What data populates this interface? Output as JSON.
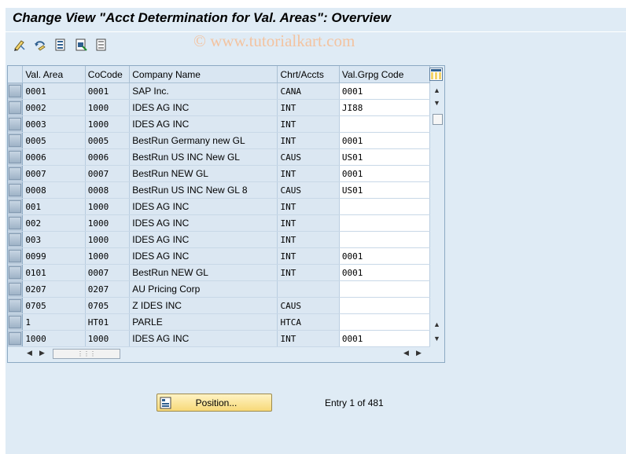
{
  "title": "Change View \"Acct Determination for Val. Areas\": Overview",
  "watermark": "© www.tutorialkart.com",
  "toolbar": {
    "icons": [
      "display-change-icon",
      "undo-change-icon",
      "select-all-icon",
      "select-block-icon",
      "deselect-all-icon"
    ]
  },
  "table": {
    "columns": [
      "Val. Area",
      "CoCode",
      "Company Name",
      "Chrt/Accts",
      "Val.Grpg Code"
    ],
    "rows": [
      [
        "0001",
        "0001",
        "SAP Inc.",
        "CANA",
        "0001"
      ],
      [
        "0002",
        "1000",
        "IDES AG INC",
        "INT",
        "JI88"
      ],
      [
        "0003",
        "1000",
        "IDES AG INC",
        "INT",
        ""
      ],
      [
        "0005",
        "0005",
        "BestRun Germany new GL",
        "INT",
        "0001"
      ],
      [
        "0006",
        "0006",
        "BestRun US INC New GL",
        "CAUS",
        "US01"
      ],
      [
        "0007",
        "0007",
        "BestRun NEW GL",
        "INT",
        "0001"
      ],
      [
        "0008",
        "0008",
        "BestRun US INC New GL 8",
        "CAUS",
        "US01"
      ],
      [
        "001",
        "1000",
        "IDES AG INC",
        "INT",
        ""
      ],
      [
        "002",
        "1000",
        "IDES AG INC",
        "INT",
        ""
      ],
      [
        "003",
        "1000",
        "IDES AG INC",
        "INT",
        ""
      ],
      [
        "0099",
        "1000",
        "IDES AG INC",
        "INT",
        "0001"
      ],
      [
        "0101",
        "0007",
        "BestRun NEW GL",
        "INT",
        "0001"
      ],
      [
        "0207",
        "0207",
        "AU Pricing Corp",
        "",
        ""
      ],
      [
        "0705",
        "0705",
        "Z IDES INC",
        "CAUS",
        ""
      ],
      [
        "1",
        "HT01",
        "PARLE",
        "HTCA",
        ""
      ],
      [
        "1000",
        "1000",
        "IDES AG INC",
        "INT",
        "0001"
      ]
    ]
  },
  "position_button": {
    "label": "Position..."
  },
  "entry_info": "Entry 1 of 481",
  "colors": {
    "background": "#dfebf5",
    "header": "#d9e6f2",
    "button": "#f7d978"
  }
}
